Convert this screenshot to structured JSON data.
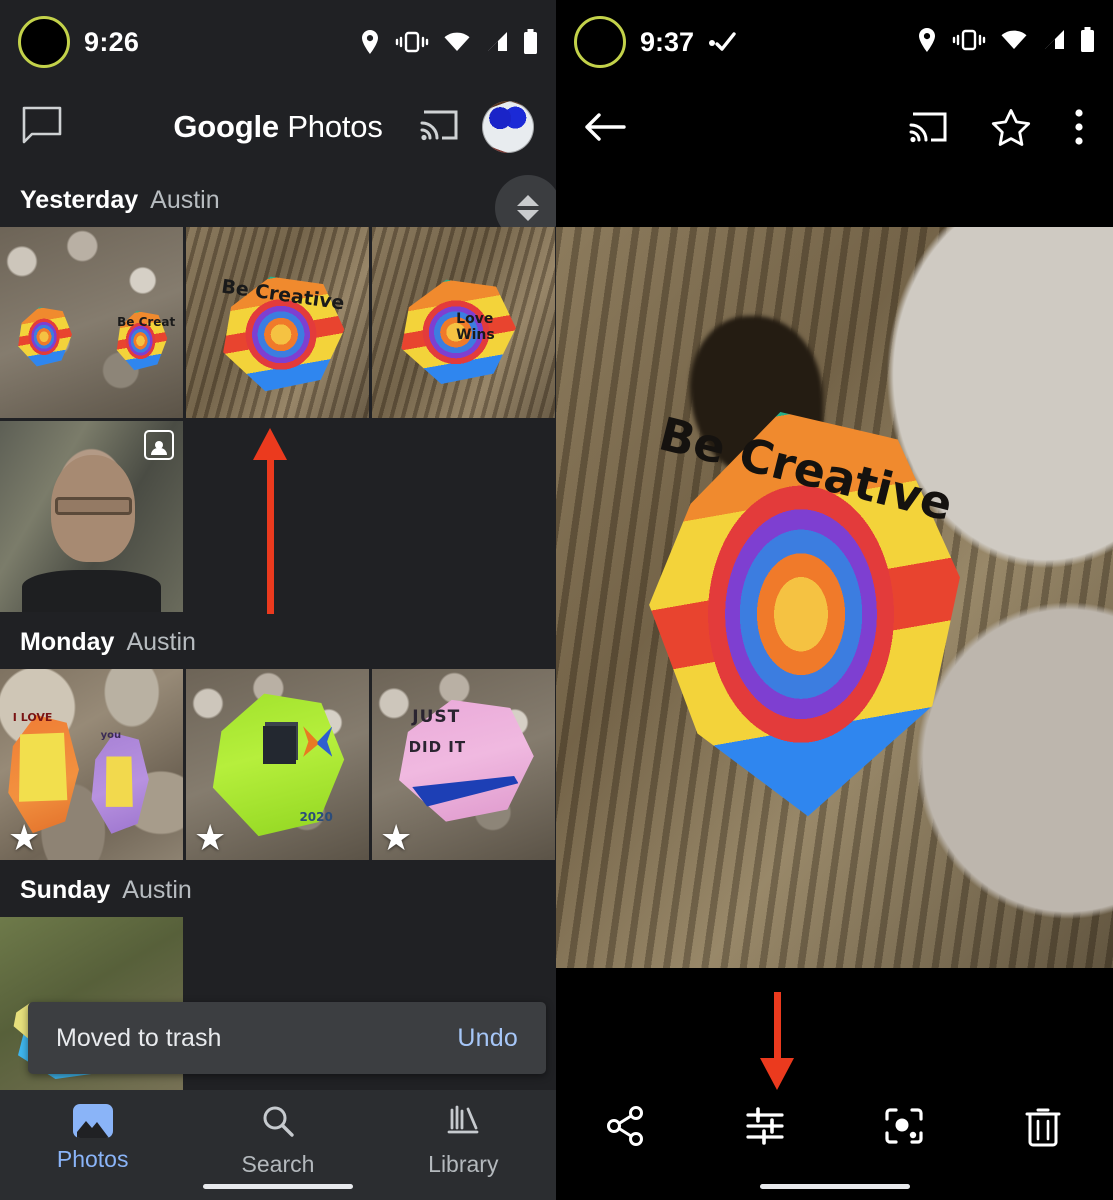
{
  "left_screen": {
    "status_bar": {
      "time": "9:26",
      "icons": [
        "location-icon",
        "vibrate-icon",
        "wifi-icon",
        "cell-signal-icon",
        "battery-icon"
      ]
    },
    "app_bar": {
      "chat_icon": "chat-bubble-icon",
      "title_bold": "Google",
      "title_light": " Photos",
      "cast_icon": "cast-icon",
      "avatar": "account-avatar"
    },
    "scroll_control": {
      "up_icon": "triangle-up-icon",
      "down_icon": "triangle-down-icon"
    },
    "sections": [
      {
        "day": "Yesterday",
        "place": "Austin",
        "items": [
          {
            "name": "two-painted-rocks-on-log",
            "starred": false,
            "badge": null
          },
          {
            "name": "be-creative-rock-thumb",
            "starred": false,
            "badge": null
          },
          {
            "name": "love-wins-rock-thumb",
            "starred": false,
            "badge": null
          },
          {
            "name": "selfie-portrait-thumb",
            "starred": false,
            "badge": "person-badge-icon"
          }
        ]
      },
      {
        "day": "Monday",
        "place": "Austin",
        "items": [
          {
            "name": "minion-rocks-i-love-you",
            "starred": true,
            "badge": null
          },
          {
            "name": "green-rock-with-cube-and-butterfly",
            "starred": true,
            "badge": null
          },
          {
            "name": "just-did-it-pink-rock",
            "starred": true,
            "badge": null
          }
        ]
      },
      {
        "day": "Sunday",
        "place": "Austin",
        "items": [
          {
            "name": "blue-yellow-rock-in-grass",
            "starred": false,
            "badge": null
          }
        ]
      }
    ],
    "snackbar": {
      "message": "Moved to trash",
      "action_label": "Undo"
    },
    "bottom_nav": [
      {
        "label": "Photos",
        "icon": "photos-icon",
        "active": true
      },
      {
        "label": "Search",
        "icon": "search-icon",
        "active": false
      },
      {
        "label": "Library",
        "icon": "library-icon",
        "active": false
      }
    ],
    "annotation": {
      "arrow": "red-up-arrow-callout"
    }
  },
  "right_screen": {
    "status_bar": {
      "time": "9:37",
      "extra_icon": "checkmark-icon",
      "icons": [
        "location-icon",
        "vibrate-icon",
        "wifi-icon",
        "cell-signal-icon",
        "battery-icon"
      ]
    },
    "app_bar": {
      "back_icon": "back-arrow-icon",
      "cast_icon": "cast-icon",
      "star_icon": "star-outline-icon",
      "overflow_icon": "more-vert-icon"
    },
    "photo": {
      "name": "be-creative-painted-rock",
      "caption_text": "Be Creative"
    },
    "bottom_toolbar": [
      {
        "name": "share-icon",
        "label": "Share"
      },
      {
        "name": "edit-sliders-icon",
        "label": "Edit"
      },
      {
        "name": "lens-icon",
        "label": "Lens"
      },
      {
        "name": "trash-icon",
        "label": "Delete"
      }
    ],
    "annotation": {
      "arrow": "red-down-arrow-callout-to-edit"
    }
  },
  "colors": {
    "left_background": "#202124",
    "right_background": "#000000",
    "surface": "#3c3e41",
    "accent_blue": "#8ab4f8",
    "link_blue": "#a6c6f7",
    "annotation_red": "#eb3a1e",
    "punchhole_ring": "#c3d24a",
    "text_primary": "#ffffff",
    "text_secondary": "#b7bcc0"
  }
}
